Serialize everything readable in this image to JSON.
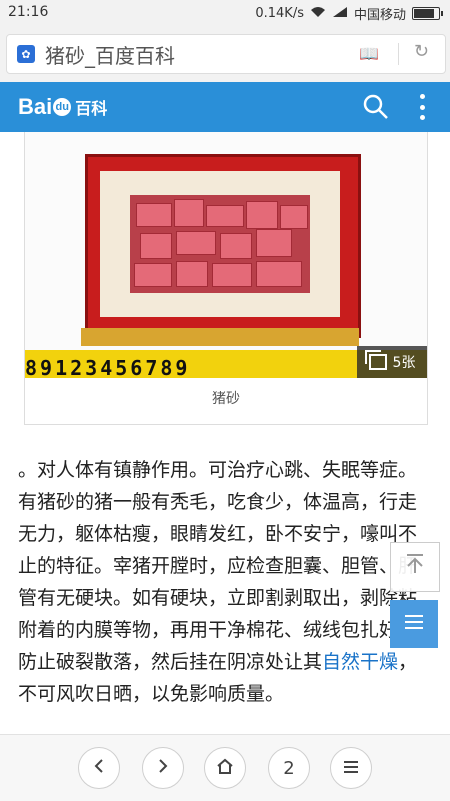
{
  "status_bar": {
    "time": "21:16",
    "speed": "0.14K/s",
    "carrier": "中国移动"
  },
  "browser": {
    "tab_title": "猪砂_百度百科"
  },
  "header": {
    "logo_bai": "Bai",
    "logo_du": "du",
    "logo_baike": "百科"
  },
  "figure": {
    "ruler_text": "89123456789",
    "photo_count": "5张",
    "caption": "猪砂"
  },
  "article": {
    "text_before_link": "。对人体有镇静作用。可治疗心跳、失眠等症。有猪砂的猪一般有秃毛，吃食少，体温高，行走无力，躯体枯瘦，眼睛发红，卧不安宁，嚎叫不止的特征。宰猪开膛时，应检查胆囊、胆管、肝管有无硬块。如有硬块，立即割剥取出，剥除粘附着的内膜等物，再用干净棉花、绒线包扎好，防止破裂散落，然后挂在阴凉处让其",
    "link_text": "自然干燥",
    "text_after_link": "，不可风吹日晒，以免影响质量。"
  },
  "bottom_nav": {
    "tab_count": "2"
  },
  "colors": {
    "header_blue": "#2a8fd8",
    "link_blue": "#1a73c8"
  }
}
